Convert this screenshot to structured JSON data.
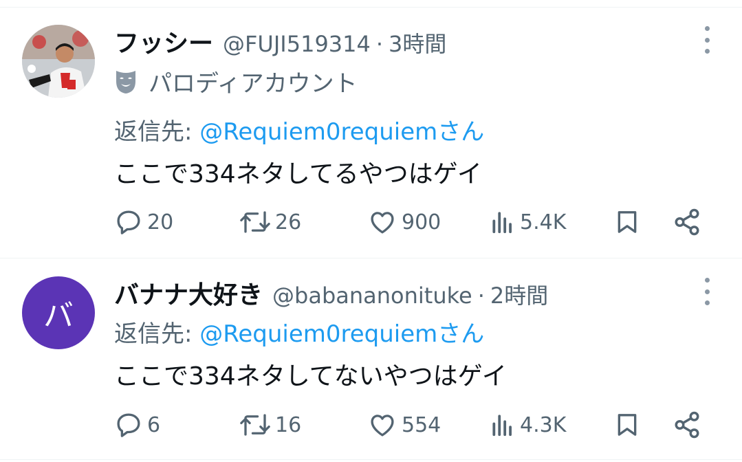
{
  "tweets": [
    {
      "display_name": "フッシー",
      "handle": "@FUJI519314",
      "separator": "·",
      "time": "3時間",
      "badge_label": "パロディアカウント",
      "reply_prefix": "返信先: ",
      "reply_user": "@Requiem0requiem",
      "reply_suffix": "さん",
      "text": "ここで334ネタしてるやつはゲイ",
      "replies": "20",
      "retweets": "26",
      "likes": "900",
      "views": "5.4K"
    },
    {
      "avatar_letter": "バ",
      "display_name": "バナナ大好き",
      "handle": "@babananonituke",
      "separator": "·",
      "time": "2時間",
      "reply_prefix": "返信先: ",
      "reply_user": "@Requiem0requiem",
      "reply_suffix": "さん",
      "text": "ここで334ネタしてないやつはゲイ",
      "replies": "6",
      "retweets": "16",
      "likes": "554",
      "views": "4.3K"
    }
  ],
  "colors": {
    "text_primary": "#0f1419",
    "text_secondary": "#536471",
    "link": "#1d9bf0",
    "avatar_bg": "#5b34b5",
    "divider": "#eff3f4"
  },
  "icons": [
    "more-icon",
    "parody-mask-icon",
    "reply-icon",
    "retweet-icon",
    "like-icon",
    "views-icon",
    "bookmark-icon",
    "share-icon"
  ]
}
